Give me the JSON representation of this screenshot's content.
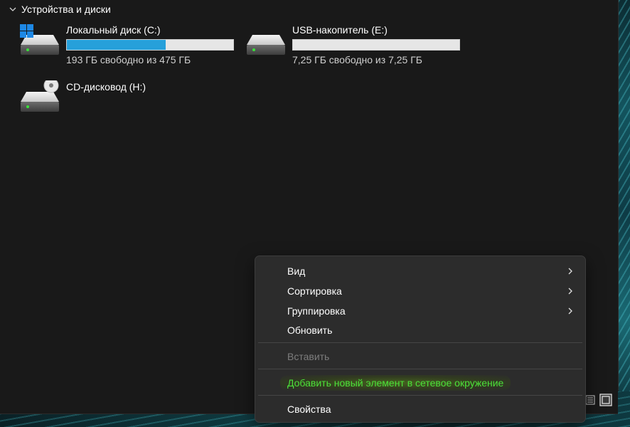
{
  "section": {
    "title": "Устройства и диски"
  },
  "drives": [
    {
      "name": "Локальный диск (C:)",
      "free_text": "193 ГБ свободно из 475 ГБ",
      "used_fraction": 0.594,
      "icon": "windows-drive-icon"
    },
    {
      "name": "USB-накопитель (E:)",
      "free_text": "7,25 ГБ свободно из 7,25 ГБ",
      "used_fraction": 0.0,
      "icon": "usb-drive-icon"
    },
    {
      "name": "CD-дисковод (H:)",
      "icon": "cd-drive-icon"
    }
  ],
  "context_menu": {
    "items": [
      {
        "label": "Вид",
        "submenu": true
      },
      {
        "label": "Сортировка",
        "submenu": true
      },
      {
        "label": "Группировка",
        "submenu": true
      },
      {
        "label": "Обновить",
        "submenu": false
      },
      {
        "label": "Вставить",
        "disabled": true
      },
      {
        "label": "Добавить новый элемент в сетевое окружение",
        "highlighted": true
      },
      {
        "label": "Свойства"
      }
    ]
  },
  "colors": {
    "accent": "#26a0da",
    "highlight_text": "#4be03a",
    "background": "#191919",
    "menu_background": "#2c2c2c"
  }
}
